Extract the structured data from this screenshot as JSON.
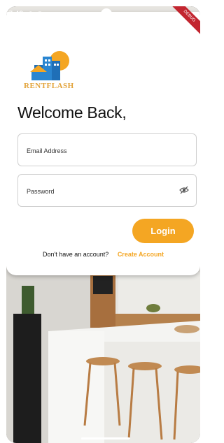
{
  "status_bar": {
    "time": "7:49"
  },
  "debug_banner": "DEBUG",
  "brand": {
    "name": "RENTFLASH",
    "accent": "#f4a623"
  },
  "login": {
    "title": "Welcome Back,",
    "email_placeholder": "Email Address",
    "password_placeholder": "Password",
    "login_label": "Login",
    "no_account_text": "Don't have an account?",
    "create_account_label": "Create Account"
  }
}
